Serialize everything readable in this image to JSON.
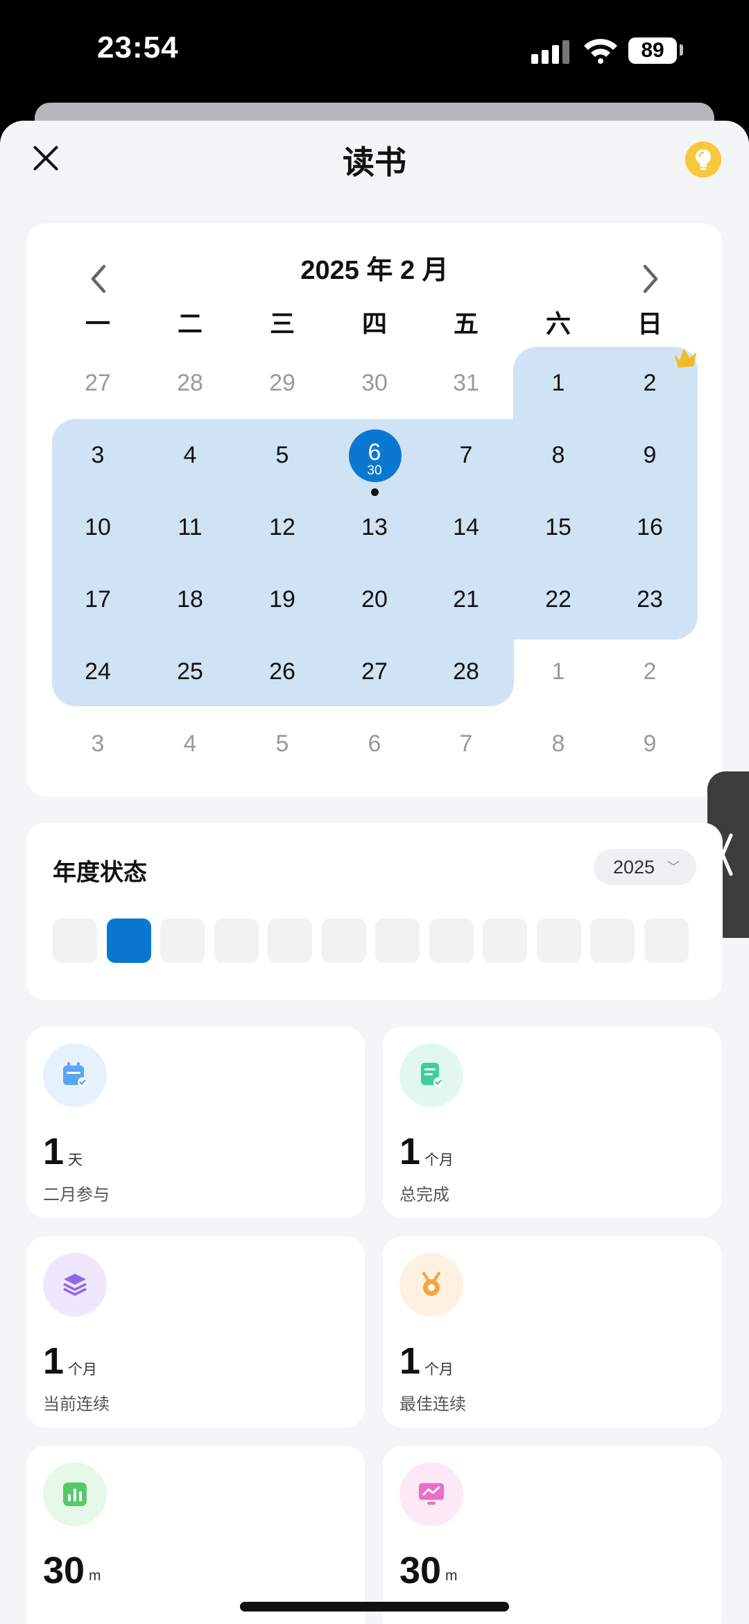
{
  "status_bar": {
    "time": "23:54",
    "battery": "89"
  },
  "header": {
    "title": "读书"
  },
  "calendar": {
    "month_label": "2025 年 2 月",
    "weekdays": [
      "一",
      "二",
      "三",
      "四",
      "五",
      "六",
      "日"
    ],
    "weeks": [
      [
        "27",
        "28",
        "29",
        "30",
        "31",
        "1",
        "2"
      ],
      [
        "3",
        "4",
        "5",
        "6",
        "7",
        "8",
        "9"
      ],
      [
        "10",
        "11",
        "12",
        "13",
        "14",
        "15",
        "16"
      ],
      [
        "17",
        "18",
        "19",
        "20",
        "21",
        "22",
        "23"
      ],
      [
        "24",
        "25",
        "26",
        "27",
        "28",
        "1",
        "2"
      ],
      [
        "3",
        "4",
        "5",
        "6",
        "7",
        "8",
        "9"
      ]
    ],
    "today": "6",
    "today_minutes": "30"
  },
  "annual": {
    "title": "年度状态",
    "year": "2025",
    "active_month_index": 1
  },
  "stats": [
    {
      "value": "1",
      "unit": "天",
      "label": "二月参与",
      "icon": "calendar-check-icon",
      "color": "#5aa6f0",
      "bg": "#e5f1fd"
    },
    {
      "value": "1",
      "unit": "个月",
      "label": "总完成",
      "icon": "document-check-icon",
      "color": "#3ccf9c",
      "bg": "#e2f8ef"
    },
    {
      "value": "1",
      "unit": "个月",
      "label": "当前连续",
      "icon": "layers-icon",
      "color": "#8f6ae6",
      "bg": "#efe8fc"
    },
    {
      "value": "1",
      "unit": "个月",
      "label": "最佳连续",
      "icon": "medal-icon",
      "color": "#f5a53c",
      "bg": "#fef1e2"
    },
    {
      "value": "30",
      "unit": "m",
      "label": "",
      "icon": "bar-chart-icon",
      "color": "#56c96a",
      "bg": "#e6f8e8"
    },
    {
      "value": "30",
      "unit": "m",
      "label": "",
      "icon": "monitor-chart-icon",
      "color": "#ee6dc9",
      "bg": "#fde8f6"
    }
  ]
}
